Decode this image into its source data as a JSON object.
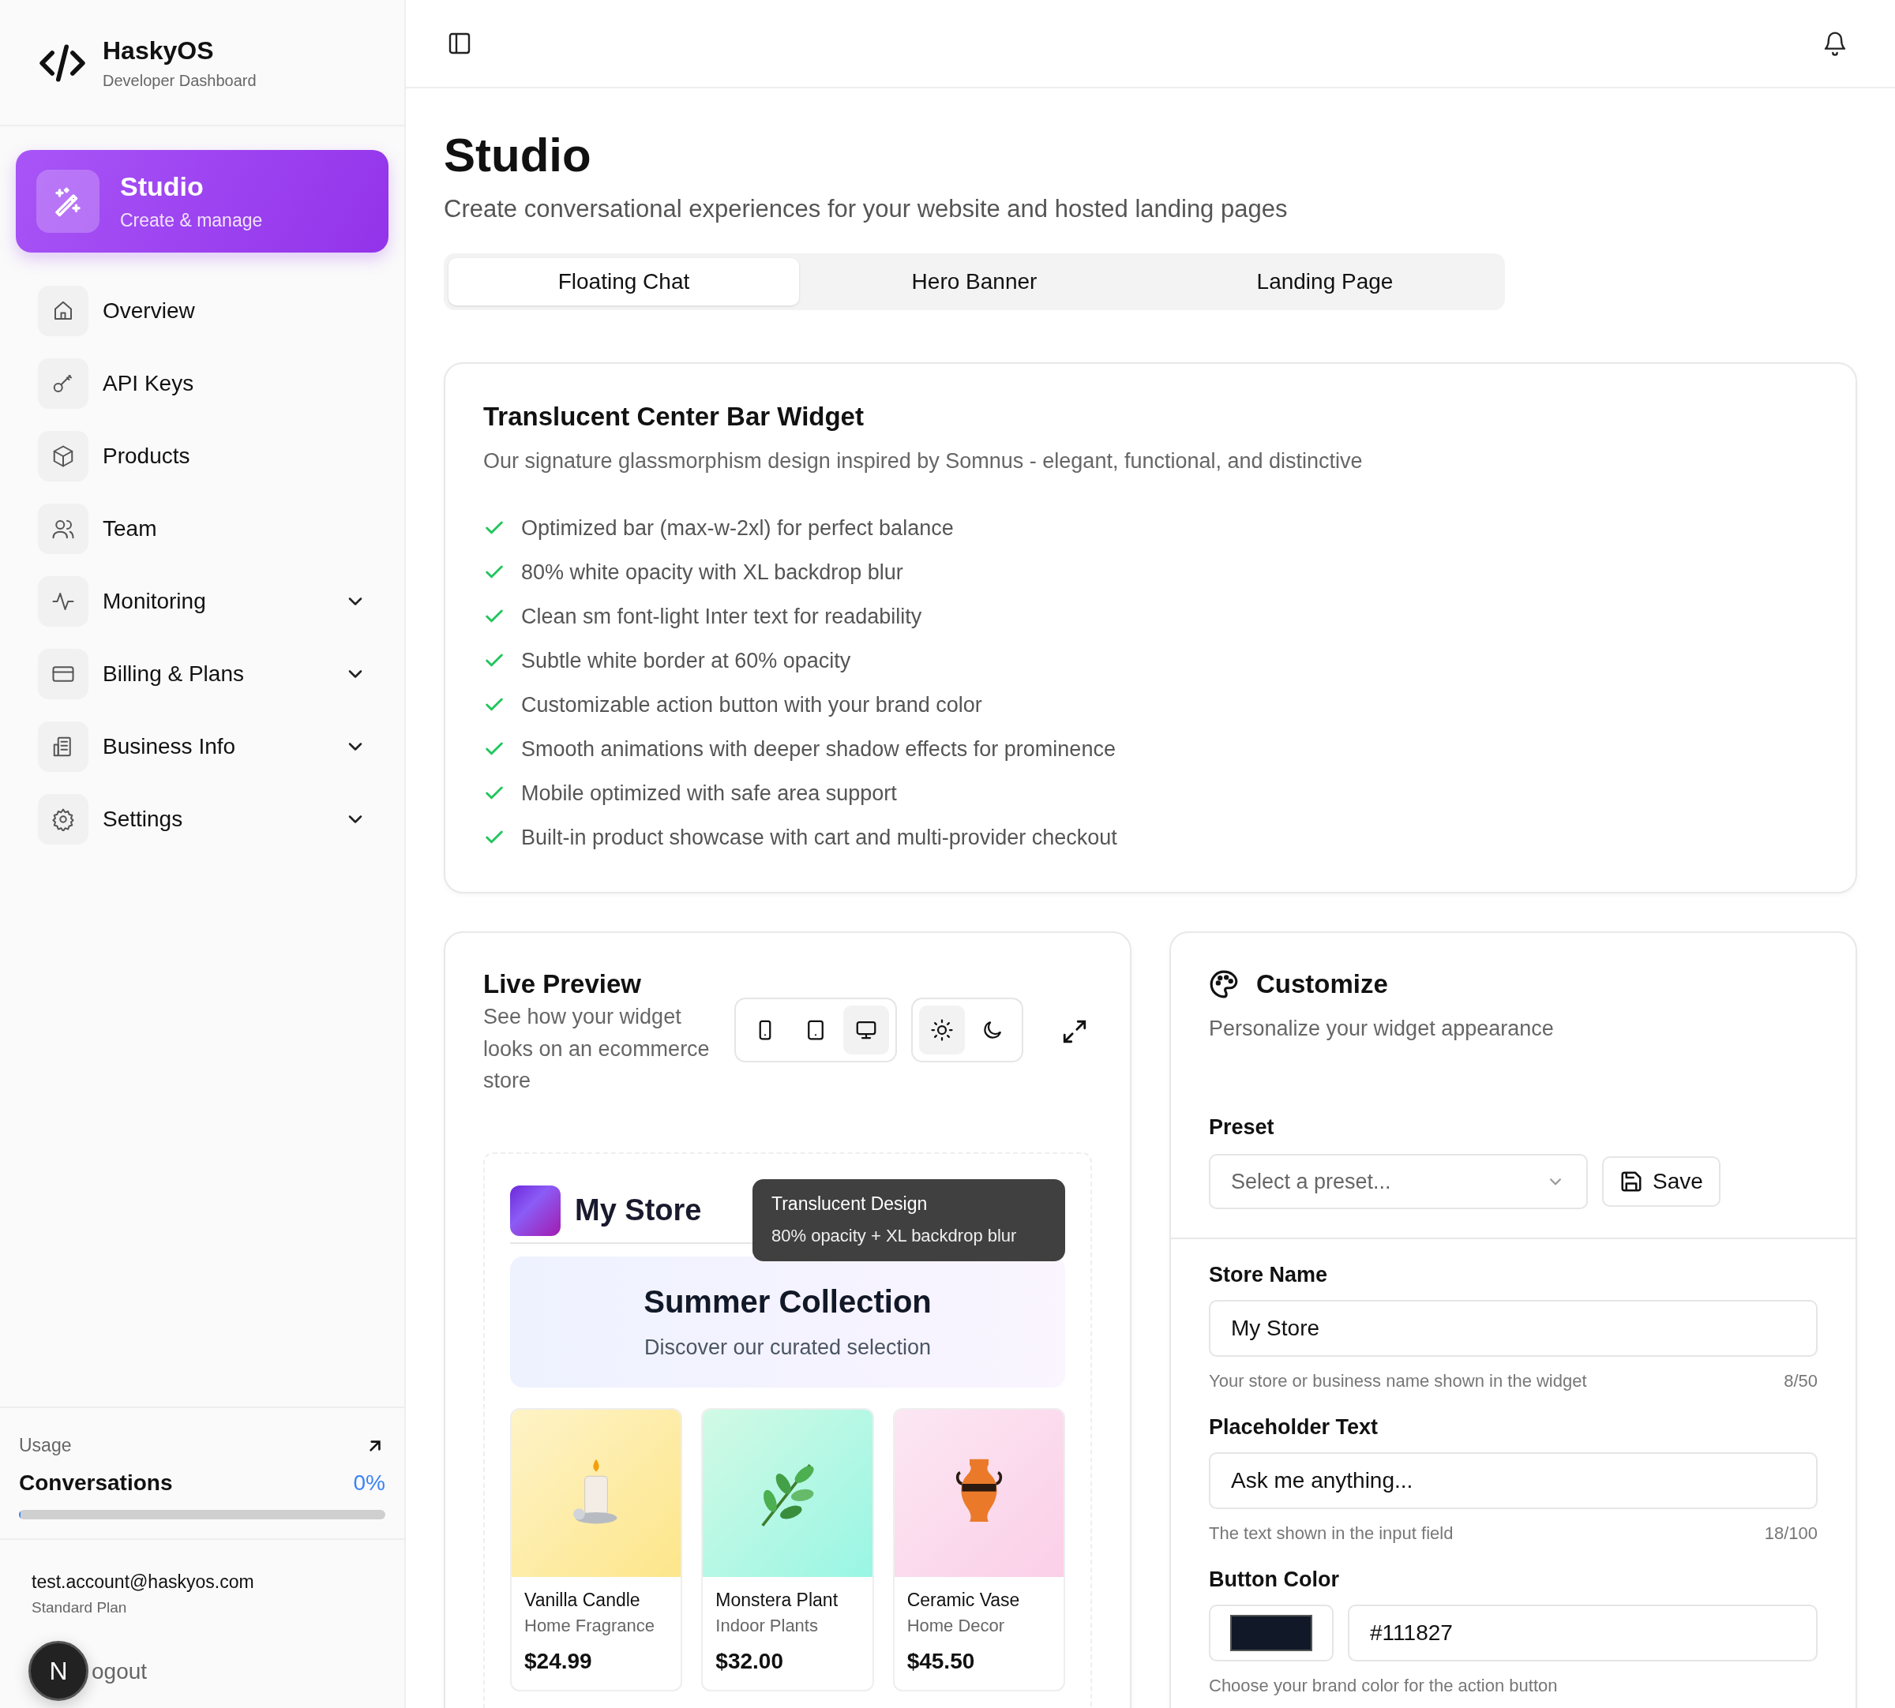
{
  "brand": {
    "name": "HaskyOS",
    "subtitle": "Developer Dashboard"
  },
  "sidebar": {
    "items": [
      {
        "label": "Studio",
        "subtitle": "Create & manage",
        "selected": true,
        "expandable": false
      },
      {
        "label": "Overview",
        "selected": false,
        "expandable": false
      },
      {
        "label": "API Keys",
        "selected": false,
        "expandable": false
      },
      {
        "label": "Products",
        "selected": false,
        "expandable": false
      },
      {
        "label": "Team",
        "selected": false,
        "expandable": false
      },
      {
        "label": "Monitoring",
        "selected": false,
        "expandable": true
      },
      {
        "label": "Billing & Plans",
        "selected": false,
        "expandable": true
      },
      {
        "label": "Business Info",
        "selected": false,
        "expandable": true
      },
      {
        "label": "Settings",
        "selected": false,
        "expandable": true
      }
    ],
    "usage": {
      "title": "Usage",
      "metric": "Conversations",
      "reading": "0%",
      "level": 0
    },
    "account": {
      "email": "test.account@haskyos.com",
      "plan": "Standard Plan",
      "logout": "ogout"
    },
    "dev_badge": {
      "label": "N"
    }
  },
  "page": {
    "title": "Studio",
    "subtitle": "Create conversational experiences for your website and hosted landing pages"
  },
  "tabs": [
    {
      "label": "Floating Chat",
      "selected": true
    },
    {
      "label": "Hero Banner",
      "selected": false
    },
    {
      "label": "Landing Page",
      "selected": false
    }
  ],
  "feature_card": {
    "title": "Translucent Center Bar Widget",
    "subtitle": "Our signature glassmorphism design inspired by Somnus - elegant, functional, and distinctive",
    "features": [
      "Optimized bar (max-w-2xl) for perfect balance",
      "80% white opacity with XL backdrop blur",
      "Clean sm font-light Inter text for readability",
      "Subtle white border at 60% opacity",
      "Customizable action button with your brand color",
      "Smooth animations with deeper shadow effects for prominence",
      "Mobile optimized with safe area support",
      "Built-in product showcase with cart and multi-provider checkout"
    ]
  },
  "live_preview": {
    "title": "Live Preview",
    "subtitle": "See how your widget looks on an ecommerce store",
    "devices": [
      {
        "kind": "phone",
        "selected": false
      },
      {
        "kind": "tablet",
        "selected": false
      },
      {
        "kind": "desktop",
        "selected": true
      }
    ],
    "themes": [
      {
        "kind": "light",
        "selected": true
      },
      {
        "kind": "dark",
        "selected": false
      }
    ],
    "store": {
      "name": "My Store",
      "tooltip_title": "Translucent Design",
      "tooltip_text": "80% opacity + XL backdrop blur",
      "banner_title": "Summer Collection",
      "banner_subtitle": "Discover our curated selection",
      "products": [
        {
          "kind": "candle",
          "name": "Vanilla Candle",
          "category": "Home Fragrance",
          "price": "$24.99"
        },
        {
          "kind": "plant",
          "name": "Monstera Plant",
          "category": "Indoor Plants",
          "price": "$32.00"
        },
        {
          "kind": "vase",
          "name": "Ceramic Vase",
          "category": "Home Decor",
          "price": "$45.50"
        }
      ]
    }
  },
  "customize": {
    "title": "Customize",
    "subtitle": "Personalize your widget appearance",
    "preset_label": "Preset",
    "preset_placeholder": "Select a preset...",
    "save_label": "Save",
    "fields": [
      {
        "kind": "text",
        "label": "Store Name",
        "value": "My Store",
        "hint": "Your store or business name shown in the widget",
        "count": "8/50"
      },
      {
        "kind": "text",
        "label": "Placeholder Text",
        "value": "Ask me anything...",
        "hint": "The text shown in the input field",
        "count": "18/100"
      },
      {
        "kind": "color",
        "label": "Button Color",
        "value": "#111827",
        "hint": "Choose your brand color for the action button"
      }
    ]
  }
}
